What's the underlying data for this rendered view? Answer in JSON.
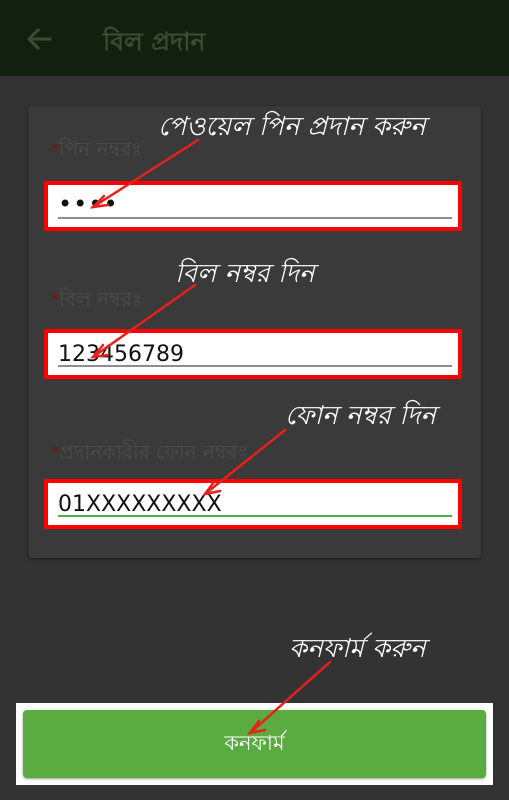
{
  "appbar": {
    "title": "বিল প্রদান",
    "back_icon": "arrow-back-icon"
  },
  "form": {
    "pin": {
      "label": "পিন নম্বরঃ",
      "required_mark": "*",
      "value": "••••"
    },
    "bill": {
      "label": "বিল নম্বরঃ",
      "required_mark": "*",
      "value": "123456789"
    },
    "phone": {
      "label": "প্রদানকারীর ফোন নম্বরঃ",
      "required_mark": "*",
      "value": "01XXXXXXXXX"
    }
  },
  "annotations": {
    "pin": "পেওয়েল পিন প্রদান করুন",
    "bill": "বিল নম্বর দিন",
    "phone": "ফোন নম্বর দিন",
    "confirm": "কনফার্ম করুন"
  },
  "confirm_button": {
    "label": "কনফার্ম"
  },
  "colors": {
    "appbar": "#13200f",
    "background": "#333333",
    "highlight": "#ff0000",
    "button": "#5aab40",
    "active_underline": "#4caf50"
  }
}
